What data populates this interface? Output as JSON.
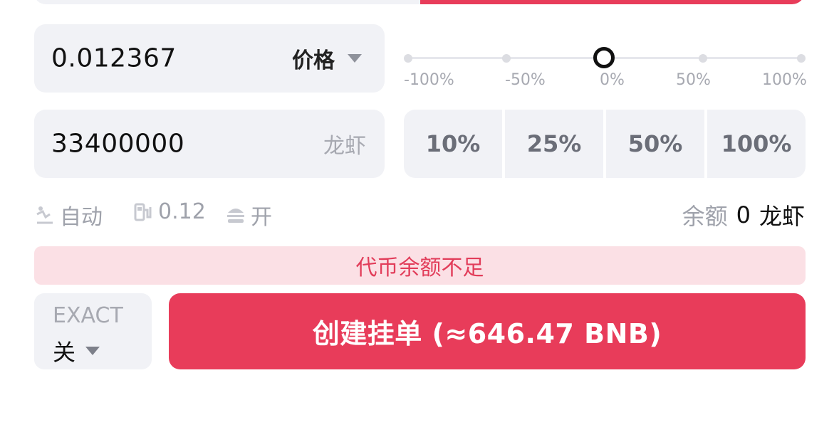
{
  "theme": {
    "accent": "#e83c5a",
    "warning_bg": "#fbe0e5",
    "field_bg": "#f1f2f6"
  },
  "price": {
    "value": "0.012367",
    "mode_label": "价格"
  },
  "amount": {
    "value": "33400000",
    "unit": "龙虾"
  },
  "slider": {
    "ticks": [
      "-100%",
      "-50%",
      "0%",
      "50%",
      "100%"
    ],
    "current": "0%"
  },
  "quick_percent": [
    "10%",
    "25%",
    "50%",
    "100%"
  ],
  "options": {
    "auto_label": "自动",
    "gas_value": "0.12",
    "toggle_label": "开"
  },
  "balance": {
    "label": "余额",
    "value": "0",
    "unit": "龙虾"
  },
  "warning": "代币余额不足",
  "exact": {
    "title": "EXACT",
    "value": "关"
  },
  "submit_label": "创建挂单 (≈646.47 BNB)"
}
